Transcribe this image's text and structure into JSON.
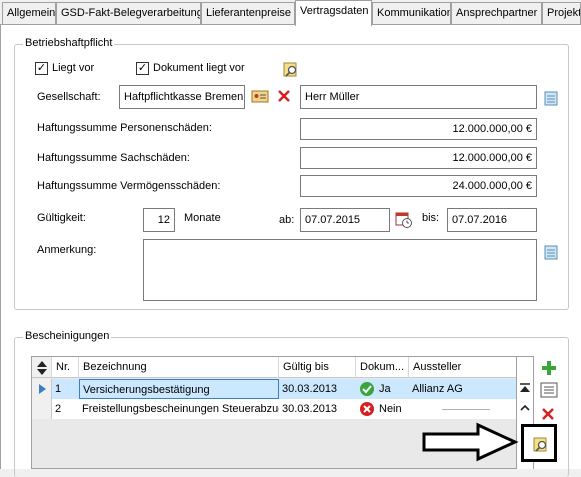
{
  "tabs": [
    "Allgemein",
    "GSD-Fakt-Belegverarbeitung",
    "Lieferantenpreise",
    "Vertragsdaten",
    "Kommunikation",
    "Ansprechpartner",
    "Projekte"
  ],
  "active_tab": "Vertragsdaten",
  "liability": {
    "title": "Betriebshaftpflicht",
    "present_label": "Liegt vor",
    "present_checked": "✓",
    "document_label": "Dokument liegt vor",
    "document_checked": "✓",
    "company_label": "Gesellschaft:",
    "company_value": "Haftpflichtkasse Bremen",
    "contact_value": "Herr Müller",
    "personal_label": "Haftungssumme Personenschäden:",
    "personal_value": "12.000.000,00 €",
    "property_label": "Haftungssumme Sachschäden:",
    "property_value": "12.000.000,00 €",
    "financial_label": "Haftungssumme Vermögensschäden:",
    "financial_value": "24.000.000,00 €",
    "validity_label": "Gültigkeit:",
    "validity_months": "12",
    "months_label": "Monate",
    "from_label": "ab:",
    "from_value": "07.07.2015",
    "to_label": "bis:",
    "to_value": "07.07.2016",
    "note_label": "Anmerkung:",
    "note_value": ""
  },
  "certificates": {
    "title": "Bescheinigungen",
    "columns": [
      "Nr.",
      "Bezeichnung",
      "Gültig bis",
      "Dokum...",
      "Aussteller"
    ],
    "rows": [
      {
        "nr": "1",
        "name": "Versicherungsbestätigung",
        "valid": "30.03.2013",
        "doc": "Ja",
        "issuer": "Allianz AG"
      },
      {
        "nr": "2",
        "name": "Freistellungsbescheinungen Steuerabzug",
        "valid": "30.03.2013",
        "doc": "Nein",
        "issuer": ""
      }
    ]
  },
  "colors": {
    "selection": "#cce8ff",
    "accent_green": "#3aa53a",
    "accent_red": "#d62020"
  }
}
